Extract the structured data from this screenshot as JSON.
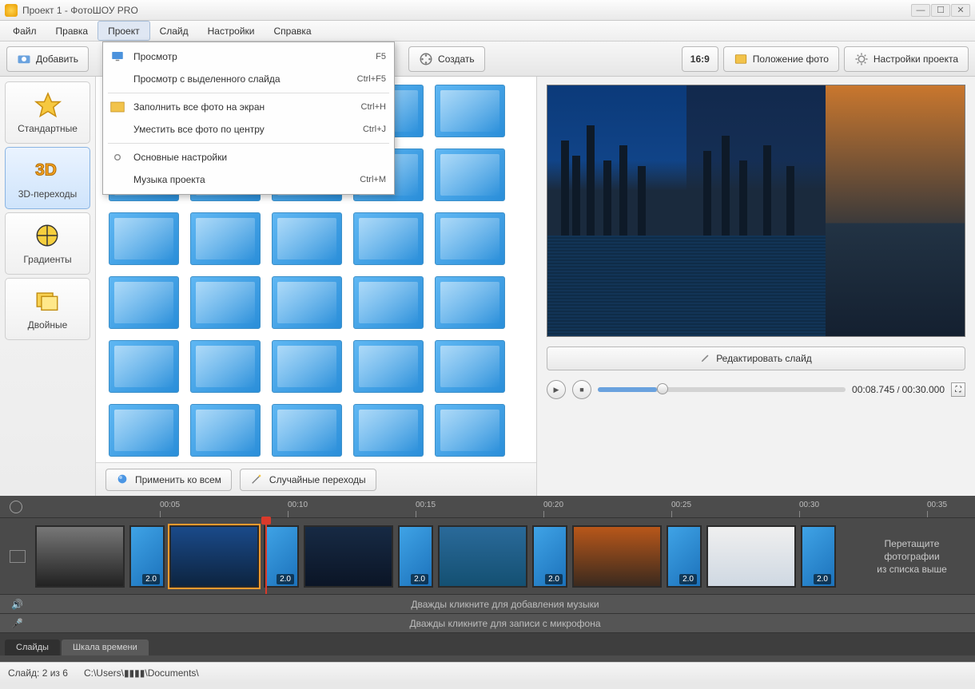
{
  "title": "Проект 1 - ФотоШОУ PRO",
  "menus": {
    "file": "Файл",
    "edit": "Правка",
    "project": "Проект",
    "slide": "Слайд",
    "settings": "Настройки",
    "help": "Справка"
  },
  "toolbar": {
    "add": "Добавить",
    "create": "Создать",
    "aspect": "16:9",
    "photo_pos": "Положение фото",
    "proj_settings": "Настройки проекта"
  },
  "dropdown": [
    {
      "icon": "monitor",
      "label": "Просмотр",
      "short": "F5"
    },
    {
      "icon": "",
      "label": "Просмотр с выделенного слайда",
      "short": "Ctrl+F5"
    },
    {
      "sep": true
    },
    {
      "icon": "photo",
      "label": "Заполнить все фото на экран",
      "short": "Ctrl+H"
    },
    {
      "icon": "",
      "label": "Уместить все фото по центру",
      "short": "Ctrl+J"
    },
    {
      "sep": true
    },
    {
      "icon": "gear",
      "label": "Основные настройки",
      "short": ""
    },
    {
      "icon": "",
      "label": "Музыка проекта",
      "short": "Ctrl+M"
    }
  ],
  "categories": [
    {
      "id": "standard",
      "label": "Стандартные"
    },
    {
      "id": "3d",
      "label": "3D-переходы",
      "selected": true
    },
    {
      "id": "gradients",
      "label": "Градиенты"
    },
    {
      "id": "double",
      "label": "Двойные"
    }
  ],
  "center_foot": {
    "apply_all": "Применить ко всем",
    "random": "Случайные переходы"
  },
  "preview": {
    "edit": "Редактировать слайд"
  },
  "playback": {
    "elapsed": "00:08.745",
    "total": "00:30.000"
  },
  "ruler_marks": [
    "00:05",
    "00:10",
    "00:15",
    "00:20",
    "00:25",
    "00:30",
    "00:35"
  ],
  "track_hint": {
    "l1": "Перетащите",
    "l2": "фотографии",
    "l3": "из списка выше"
  },
  "clip_duration": "2.0",
  "audio_hint_1": "Дважды кликните для добавления музыки",
  "audio_hint_2": "Дважды кликните для записи с микрофона",
  "tabs": {
    "slides": "Слайды",
    "timeline": "Шкала времени"
  },
  "status": {
    "slide": "Слайд: 2 из 6",
    "path_prefix": "C:\\Users\\",
    "path_suffix": "\\Documents\\"
  }
}
